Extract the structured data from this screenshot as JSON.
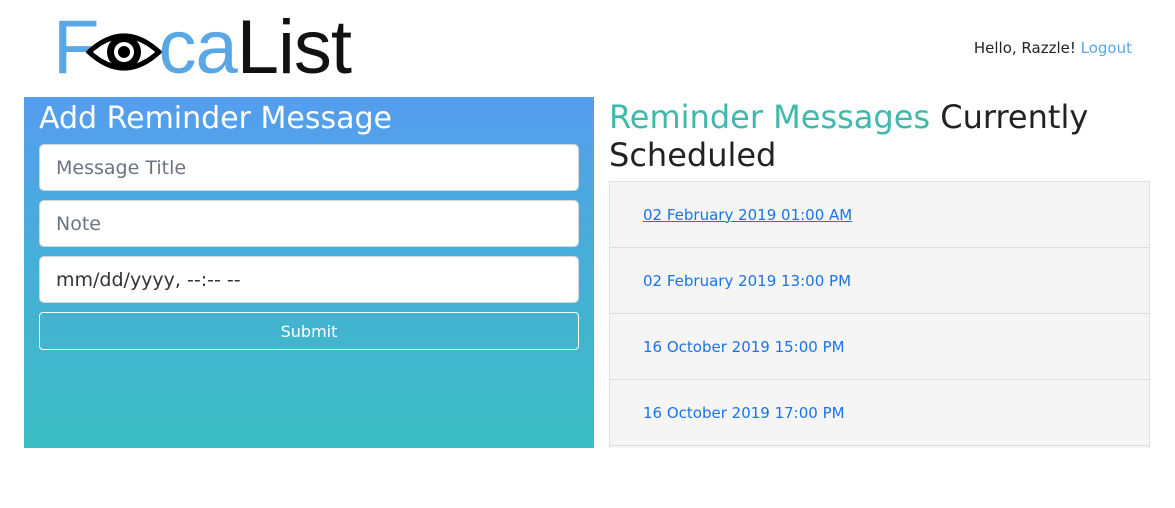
{
  "header": {
    "logo_part1": "F",
    "logo_part2": "ca",
    "logo_part3": "List",
    "greeting": "Hello, Razzle!",
    "logout_label": "Logout"
  },
  "add_form": {
    "title": "Add Reminder Message",
    "title_placeholder": "Message Title",
    "note_placeholder": "Note",
    "date_value": "mm/dd/yyyy, --:-- --",
    "submit_label": "Submit"
  },
  "scheduled": {
    "title_accent": "Reminder Messages",
    "title_rest": " Currently Scheduled",
    "items": [
      {
        "label": "02 February 2019 01:00 AM"
      },
      {
        "label": "02 February 2019 13:00 PM"
      },
      {
        "label": "16 October 2019 15:00 PM"
      },
      {
        "label": "16 October 2019 17:00 PM"
      }
    ]
  },
  "colors": {
    "brand_blue": "#5aa7e6",
    "accent_teal": "#3fb9a9",
    "panel_gradient_top": "#559def",
    "panel_gradient_bottom": "#3bbec3",
    "link_blue": "#1a73e8"
  }
}
